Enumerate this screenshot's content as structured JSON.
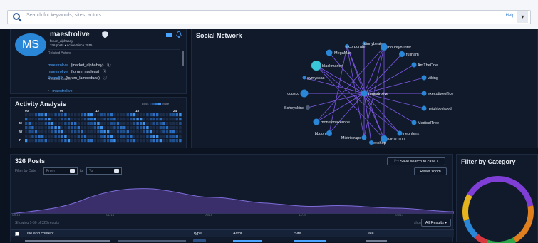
{
  "search": {
    "placeholder": "Search for keywords, sites, actors",
    "help": "Help",
    "dropdown_icon": "chevron-down-icon"
  },
  "profile": {
    "initials": "MS",
    "name": "maestrolive",
    "username": "forum_alphabay",
    "stats": "326 posts • Active Since 2015",
    "related_actors_heading": "Related Actors",
    "related_actors": [
      {
        "name": "maestrolive",
        "forum": "(market_alphabay)"
      },
      {
        "name": "maestrolive",
        "forum": "(forum_nucleus)"
      },
      {
        "name": "Demo89",
        "forum": "(forum_lampeduza)"
      }
    ],
    "related_cases_heading": "Related Cases",
    "related_case": "maestrolive"
  },
  "activity": {
    "title": "Activity Analysis",
    "legend_less": "Less",
    "legend_more": "More",
    "hours": [
      "00",
      "06",
      "12",
      "18",
      "24"
    ],
    "days": [
      "M",
      "W",
      "F"
    ]
  },
  "network": {
    "title": "Social Network",
    "center": "maestrolive",
    "nodes": [
      "incorporate",
      "cinnybeats",
      "bountyhunter",
      "MegaMan",
      "fullham",
      "blackmarket",
      "AmTheOne",
      "gymyscas",
      "Viking",
      "ccukcc",
      "executiveoffice",
      "Scheyskine",
      "neighborhood",
      "moneymakerone",
      "MedicalTree",
      "bbdon",
      "neonlenz",
      "Mistristraps",
      "virus1017",
      "Hexshop"
    ]
  },
  "posts": {
    "title": "326 Posts",
    "save_label": "Save search to case",
    "filter_label": "Filter by Date",
    "from_placeholder": "From",
    "to_label": "to",
    "to_placeholder": "To",
    "reset_label": "Reset zoom",
    "x_ticks": [
      "08/15",
      "01/16",
      "06/16",
      "11/16",
      "04/17"
    ],
    "showing": "Showing 1-50 of 326 results",
    "show_label": "show",
    "show_value": "All Results",
    "columns": [
      "Title and content",
      "Type",
      "Actor",
      "Site",
      "Date"
    ]
  },
  "category": {
    "title": "Filter by Category"
  },
  "colors": {
    "accent": "#2a86d6",
    "link": "#4aa3ff",
    "donut": [
      "#7f3fd6",
      "#e07f1e",
      "#2aa84a",
      "#d6383f",
      "#2a86d6",
      "#e6b51e"
    ]
  }
}
